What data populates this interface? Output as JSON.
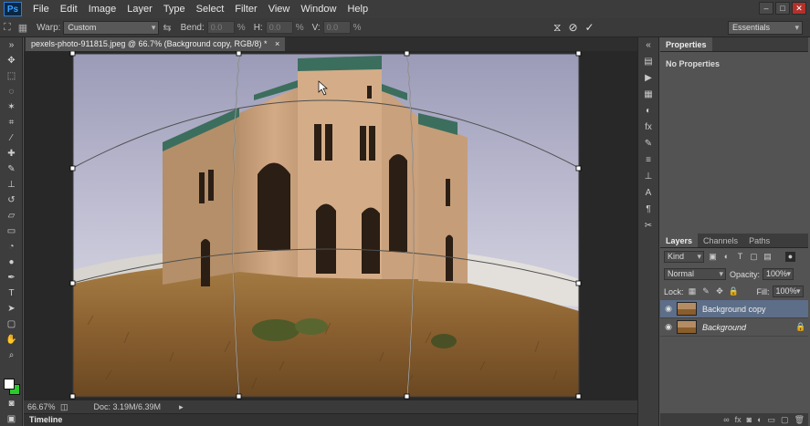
{
  "app": {
    "logo": "Ps"
  },
  "menu": [
    "File",
    "Edit",
    "Image",
    "Layer",
    "Type",
    "Select",
    "Filter",
    "View",
    "Window",
    "Help"
  ],
  "window_controls": {
    "minimize": "–",
    "maximize": "□",
    "close": "✕"
  },
  "options": {
    "warp_label": "Warp:",
    "warp_value": "Custom",
    "bend_label": "Bend:",
    "bend_value": "0.0",
    "h_label": "H:",
    "h_value": "0.0",
    "v_label": "V:",
    "v_value": "0.0",
    "pct": "%",
    "workspace": "Essentials"
  },
  "document": {
    "tab_title": "pexels-photo-911815.jpeg @ 66.7% (Background copy, RGB/8) *",
    "close": "×"
  },
  "status": {
    "zoom": "66.67%",
    "doc_info": "Doc: 3.19M/6.39M"
  },
  "timeline": {
    "label": "Timeline"
  },
  "properties": {
    "tab": "Properties",
    "body": "No Properties"
  },
  "layers": {
    "tabs": [
      "Layers",
      "Channels",
      "Paths"
    ],
    "kind_filter": "Kind",
    "blend_mode": "Normal",
    "opacity_label": "Opacity:",
    "opacity_value": "100%",
    "lock_label": "Lock:",
    "fill_label": "Fill:",
    "fill_value": "100%",
    "items": [
      {
        "name": "Background copy",
        "selected": true,
        "locked": false
      },
      {
        "name": "Background",
        "selected": false,
        "locked": true
      }
    ]
  },
  "colors": {
    "foreground": "#ffffff",
    "background": "#2cc92c",
    "accent_selected_layer": "#5d6e88"
  }
}
